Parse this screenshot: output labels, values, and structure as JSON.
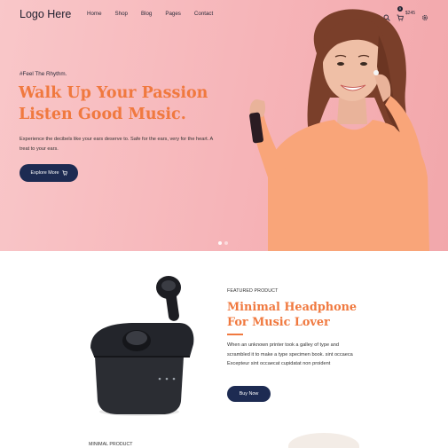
{
  "header": {
    "logo": "Logo Here",
    "nav": [
      "Home",
      "Shop",
      "Blog",
      "Pages",
      "Contact"
    ],
    "cart_count": "0",
    "cart_total": "$245",
    "icons": [
      "search-icon",
      "cart-icon",
      "settings-icon"
    ]
  },
  "hero": {
    "tagline": "#Feel The Rhythm.",
    "headline_line1": "Walk Up Your Passion",
    "headline_line2": "Listen Good Music.",
    "description": "Experience the decibels like your ears deserve to. Safe for the ears, very for the heart. A treat to your ears.",
    "button_label": "Explore More",
    "slides": 2,
    "active_slide": 1
  },
  "featured": {
    "label": "FEATURED PRODUCT",
    "title_line1": "Minimal Headphone",
    "title_line2": "For Music Lover",
    "description": "When an unknown printer took a galley of type and scrambled it to make a type specimen book. sint occaeca Excepteur sint occaecat cupidatat non proident",
    "button_label": "Buy Now"
  },
  "next_section": {
    "label": "MINIMAL PRODUCT"
  },
  "colors": {
    "accent": "#f0793f",
    "navy": "#1d2b52",
    "hero_bg": "#f6b4b8"
  }
}
